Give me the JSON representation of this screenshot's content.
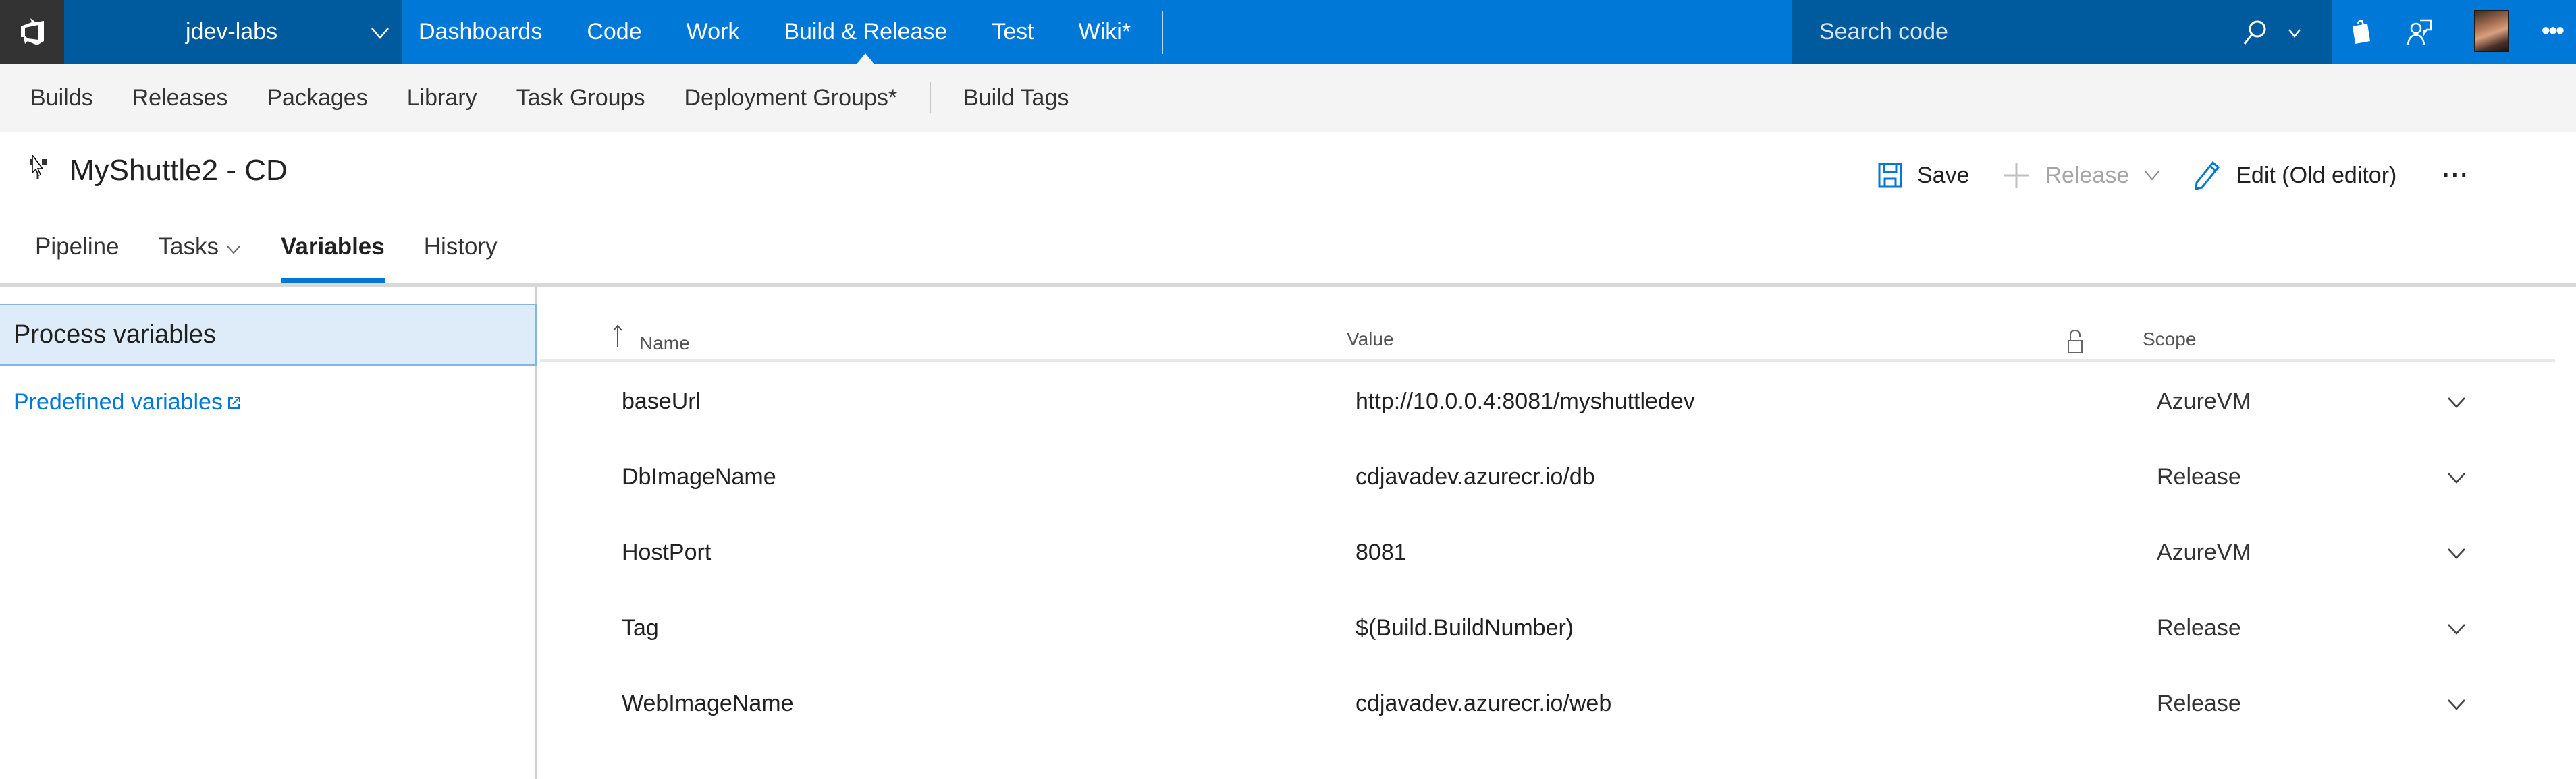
{
  "topbar": {
    "logo": "vsts-logo-icon",
    "account_name": "jdev-labs",
    "hubs": [
      {
        "label": "Dashboards",
        "active": false
      },
      {
        "label": "Code",
        "active": false
      },
      {
        "label": "Work",
        "active": false
      },
      {
        "label": "Build & Release",
        "active": true
      },
      {
        "label": "Test",
        "active": false
      },
      {
        "label": "Wiki*",
        "active": false
      }
    ],
    "search": {
      "placeholder": "Search code",
      "value": ""
    },
    "icons": [
      "search-icon",
      "chevron-down-icon",
      "marketplace-bag-icon",
      "feedback-person-icon",
      "avatar",
      "more-icon"
    ],
    "more_label": "•••"
  },
  "subnav": {
    "items": [
      "Builds",
      "Releases",
      "Packages",
      "Library",
      "Task Groups",
      "Deployment Groups*"
    ],
    "extra_items": [
      "Build Tags"
    ]
  },
  "header": {
    "title": "MyShuttle2 - CD",
    "toolbar": {
      "save_label": "Save",
      "release_label": "Release",
      "edit_label": "Edit (Old editor)",
      "more_label": "···"
    }
  },
  "tabs": [
    {
      "label": "Pipeline",
      "active": false,
      "has_dropdown": false
    },
    {
      "label": "Tasks",
      "active": false,
      "has_dropdown": true
    },
    {
      "label": "Variables",
      "active": true,
      "has_dropdown": false
    },
    {
      "label": "History",
      "active": false,
      "has_dropdown": false
    }
  ],
  "left_panel": {
    "selected_item": "Process variables",
    "link_label": "Predefined variables"
  },
  "table": {
    "columns": {
      "name": "Name",
      "value": "Value",
      "secret": "lock-icon",
      "scope": "Scope"
    },
    "sort": {
      "column": "Name",
      "direction": "ascending"
    },
    "rows": [
      {
        "name": "baseUrl",
        "value": "http://10.0.0.4:8081/myshuttledev",
        "scope": "AzureVM"
      },
      {
        "name": "DbImageName",
        "value": "cdjavadev.azurecr.io/db",
        "scope": "Release"
      },
      {
        "name": "HostPort",
        "value": "8081",
        "scope": "AzureVM"
      },
      {
        "name": "Tag",
        "value": "$(Build.BuildNumber)",
        "scope": "Release"
      },
      {
        "name": "WebImageName",
        "value": "cdjavadev.azurecr.io/web",
        "scope": "Release"
      }
    ]
  },
  "colors": {
    "brand_blue": "#0078d7",
    "dark_blue": "#005a9e",
    "logo_bg": "#333333",
    "subnav_bg": "#f4f4f4",
    "selected_bg": "#deecf9"
  }
}
